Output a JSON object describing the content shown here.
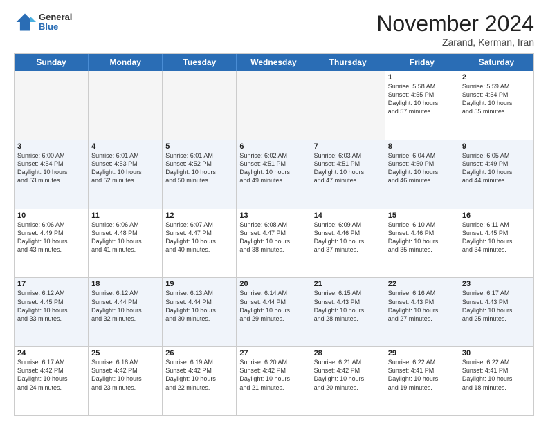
{
  "logo": {
    "general": "General",
    "blue": "Blue"
  },
  "header": {
    "month": "November 2024",
    "location": "Zarand, Kerman, Iran"
  },
  "weekdays": [
    "Sunday",
    "Monday",
    "Tuesday",
    "Wednesday",
    "Thursday",
    "Friday",
    "Saturday"
  ],
  "rows": [
    [
      {
        "day": "",
        "info": "",
        "empty": true
      },
      {
        "day": "",
        "info": "",
        "empty": true
      },
      {
        "day": "",
        "info": "",
        "empty": true
      },
      {
        "day": "",
        "info": "",
        "empty": true
      },
      {
        "day": "",
        "info": "",
        "empty": true
      },
      {
        "day": "1",
        "info": "Sunrise: 5:58 AM\nSunset: 4:55 PM\nDaylight: 10 hours\nand 57 minutes.",
        "empty": false
      },
      {
        "day": "2",
        "info": "Sunrise: 5:59 AM\nSunset: 4:54 PM\nDaylight: 10 hours\nand 55 minutes.",
        "empty": false
      }
    ],
    [
      {
        "day": "3",
        "info": "Sunrise: 6:00 AM\nSunset: 4:54 PM\nDaylight: 10 hours\nand 53 minutes.",
        "empty": false
      },
      {
        "day": "4",
        "info": "Sunrise: 6:01 AM\nSunset: 4:53 PM\nDaylight: 10 hours\nand 52 minutes.",
        "empty": false
      },
      {
        "day": "5",
        "info": "Sunrise: 6:01 AM\nSunset: 4:52 PM\nDaylight: 10 hours\nand 50 minutes.",
        "empty": false
      },
      {
        "day": "6",
        "info": "Sunrise: 6:02 AM\nSunset: 4:51 PM\nDaylight: 10 hours\nand 49 minutes.",
        "empty": false
      },
      {
        "day": "7",
        "info": "Sunrise: 6:03 AM\nSunset: 4:51 PM\nDaylight: 10 hours\nand 47 minutes.",
        "empty": false
      },
      {
        "day": "8",
        "info": "Sunrise: 6:04 AM\nSunset: 4:50 PM\nDaylight: 10 hours\nand 46 minutes.",
        "empty": false
      },
      {
        "day": "9",
        "info": "Sunrise: 6:05 AM\nSunset: 4:49 PM\nDaylight: 10 hours\nand 44 minutes.",
        "empty": false
      }
    ],
    [
      {
        "day": "10",
        "info": "Sunrise: 6:06 AM\nSunset: 4:49 PM\nDaylight: 10 hours\nand 43 minutes.",
        "empty": false
      },
      {
        "day": "11",
        "info": "Sunrise: 6:06 AM\nSunset: 4:48 PM\nDaylight: 10 hours\nand 41 minutes.",
        "empty": false
      },
      {
        "day": "12",
        "info": "Sunrise: 6:07 AM\nSunset: 4:47 PM\nDaylight: 10 hours\nand 40 minutes.",
        "empty": false
      },
      {
        "day": "13",
        "info": "Sunrise: 6:08 AM\nSunset: 4:47 PM\nDaylight: 10 hours\nand 38 minutes.",
        "empty": false
      },
      {
        "day": "14",
        "info": "Sunrise: 6:09 AM\nSunset: 4:46 PM\nDaylight: 10 hours\nand 37 minutes.",
        "empty": false
      },
      {
        "day": "15",
        "info": "Sunrise: 6:10 AM\nSunset: 4:46 PM\nDaylight: 10 hours\nand 35 minutes.",
        "empty": false
      },
      {
        "day": "16",
        "info": "Sunrise: 6:11 AM\nSunset: 4:45 PM\nDaylight: 10 hours\nand 34 minutes.",
        "empty": false
      }
    ],
    [
      {
        "day": "17",
        "info": "Sunrise: 6:12 AM\nSunset: 4:45 PM\nDaylight: 10 hours\nand 33 minutes.",
        "empty": false
      },
      {
        "day": "18",
        "info": "Sunrise: 6:12 AM\nSunset: 4:44 PM\nDaylight: 10 hours\nand 32 minutes.",
        "empty": false
      },
      {
        "day": "19",
        "info": "Sunrise: 6:13 AM\nSunset: 4:44 PM\nDaylight: 10 hours\nand 30 minutes.",
        "empty": false
      },
      {
        "day": "20",
        "info": "Sunrise: 6:14 AM\nSunset: 4:44 PM\nDaylight: 10 hours\nand 29 minutes.",
        "empty": false
      },
      {
        "day": "21",
        "info": "Sunrise: 6:15 AM\nSunset: 4:43 PM\nDaylight: 10 hours\nand 28 minutes.",
        "empty": false
      },
      {
        "day": "22",
        "info": "Sunrise: 6:16 AM\nSunset: 4:43 PM\nDaylight: 10 hours\nand 27 minutes.",
        "empty": false
      },
      {
        "day": "23",
        "info": "Sunrise: 6:17 AM\nSunset: 4:43 PM\nDaylight: 10 hours\nand 25 minutes.",
        "empty": false
      }
    ],
    [
      {
        "day": "24",
        "info": "Sunrise: 6:17 AM\nSunset: 4:42 PM\nDaylight: 10 hours\nand 24 minutes.",
        "empty": false
      },
      {
        "day": "25",
        "info": "Sunrise: 6:18 AM\nSunset: 4:42 PM\nDaylight: 10 hours\nand 23 minutes.",
        "empty": false
      },
      {
        "day": "26",
        "info": "Sunrise: 6:19 AM\nSunset: 4:42 PM\nDaylight: 10 hours\nand 22 minutes.",
        "empty": false
      },
      {
        "day": "27",
        "info": "Sunrise: 6:20 AM\nSunset: 4:42 PM\nDaylight: 10 hours\nand 21 minutes.",
        "empty": false
      },
      {
        "day": "28",
        "info": "Sunrise: 6:21 AM\nSunset: 4:42 PM\nDaylight: 10 hours\nand 20 minutes.",
        "empty": false
      },
      {
        "day": "29",
        "info": "Sunrise: 6:22 AM\nSunset: 4:41 PM\nDaylight: 10 hours\nand 19 minutes.",
        "empty": false
      },
      {
        "day": "30",
        "info": "Sunrise: 6:22 AM\nSunset: 4:41 PM\nDaylight: 10 hours\nand 18 minutes.",
        "empty": false
      }
    ]
  ]
}
